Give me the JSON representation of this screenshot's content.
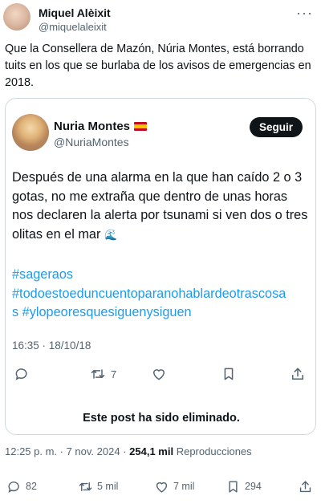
{
  "outer_tweet": {
    "author_name": "Miquel Alèixit",
    "author_handle": "@miquelaleixit",
    "text": "Que la Consellera de Mazón, Núria Montes, está borrando tuits en los que se burlaba de los avisos de emergencias en 2018.",
    "more_icon": "more-horizontal-icon",
    "timestamp": "12:25 p. m. · 7 nov. 2024 ·",
    "views_count": "254,1 mil",
    "views_label": "Reproducciones",
    "actions": {
      "replies": "82",
      "retweets": "5 mil",
      "likes": "7 mil",
      "bookmarks": "294"
    }
  },
  "quoted_tweet": {
    "author_name": "Nuria Montes",
    "author_flag": "spain-flag-icon",
    "author_handle": "@NuriaMontes",
    "follow_label": "Seguir",
    "body": "Después de una alarma en la que han caído 2 o 3 gotas, no me extraña que dentro de unas horas nos declaren la alerta por tsunami si ven dos o tres olitas en el mar",
    "emoji": "🌊",
    "hashtags": [
      "#sageraos",
      "#todoestoeduncuentoparanohablardeotrascosa",
      "s #ylopeoresquesiguenysiguen"
    ],
    "timestamp": "16:35 · 18/10/18",
    "actions": {
      "replies": "",
      "retweets": "7",
      "likes": "",
      "bookmarks": ""
    },
    "deleted_notice": "Este post ha sido eliminado."
  },
  "colors": {
    "accent": "#1d9bf0",
    "text": "#0f1419",
    "muted": "#536471",
    "border": "#cfd9de"
  }
}
